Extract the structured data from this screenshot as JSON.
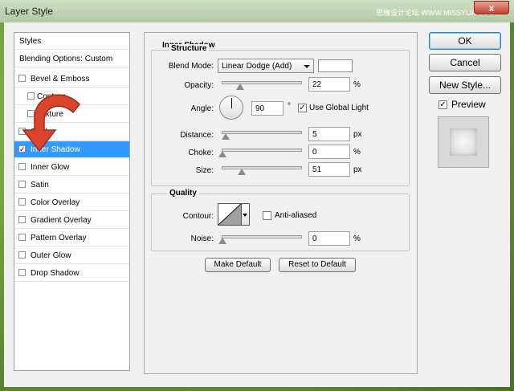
{
  "window": {
    "title": "Layer Style",
    "watermark": "思缘设计论坛 WWW.MISSYUAN.COM",
    "close_label": "x"
  },
  "styles_list": {
    "items": [
      {
        "label": "Styles",
        "kind": "header"
      },
      {
        "label": "Blending Options: Custom",
        "kind": "header"
      },
      {
        "label": "Bevel & Emboss",
        "kind": "item",
        "checked": false
      },
      {
        "label": "Contour",
        "kind": "sub",
        "checked": false
      },
      {
        "label": "Texture",
        "kind": "sub",
        "checked": false
      },
      {
        "label": "Stroke",
        "kind": "item",
        "checked": false
      },
      {
        "label": "Inner Shadow",
        "kind": "item",
        "checked": true,
        "selected": true
      },
      {
        "label": "Inner Glow",
        "kind": "item",
        "checked": false
      },
      {
        "label": "Satin",
        "kind": "item",
        "checked": false
      },
      {
        "label": "Color Overlay",
        "kind": "item",
        "checked": false
      },
      {
        "label": "Gradient Overlay",
        "kind": "item",
        "checked": false
      },
      {
        "label": "Pattern Overlay",
        "kind": "item",
        "checked": false
      },
      {
        "label": "Outer Glow",
        "kind": "item",
        "checked": false
      },
      {
        "label": "Drop Shadow",
        "kind": "item",
        "checked": false
      }
    ],
    "arrow_color": "#d9442c"
  },
  "inner_shadow": {
    "title": "Inner Shadow",
    "structure": {
      "title": "Structure",
      "blend_mode_label": "Blend Mode:",
      "blend_mode_value": "Linear Dodge (Add)",
      "shadow_color": "#ffffff",
      "opacity_label": "Opacity:",
      "opacity_value": "22",
      "opacity_unit": "%",
      "angle_label": "Angle:",
      "angle_value": "90",
      "angle_unit": "°",
      "use_global_light_label": "Use Global Light",
      "use_global_light_checked": true,
      "distance_label": "Distance:",
      "distance_value": "5",
      "distance_unit": "px",
      "choke_label": "Choke:",
      "choke_value": "0",
      "choke_unit": "%",
      "size_label": "Size:",
      "size_value": "51",
      "size_unit": "px"
    },
    "quality": {
      "title": "Quality",
      "contour_label": "Contour:",
      "anti_aliased_label": "Anti-aliased",
      "anti_aliased_checked": false,
      "noise_label": "Noise:",
      "noise_value": "0",
      "noise_unit": "%"
    },
    "make_default_label": "Make Default",
    "reset_default_label": "Reset to Default"
  },
  "actions": {
    "ok_label": "OK",
    "cancel_label": "Cancel",
    "new_style_label": "New Style...",
    "preview_label": "Preview",
    "preview_checked": true
  },
  "check_mark": "✓"
}
